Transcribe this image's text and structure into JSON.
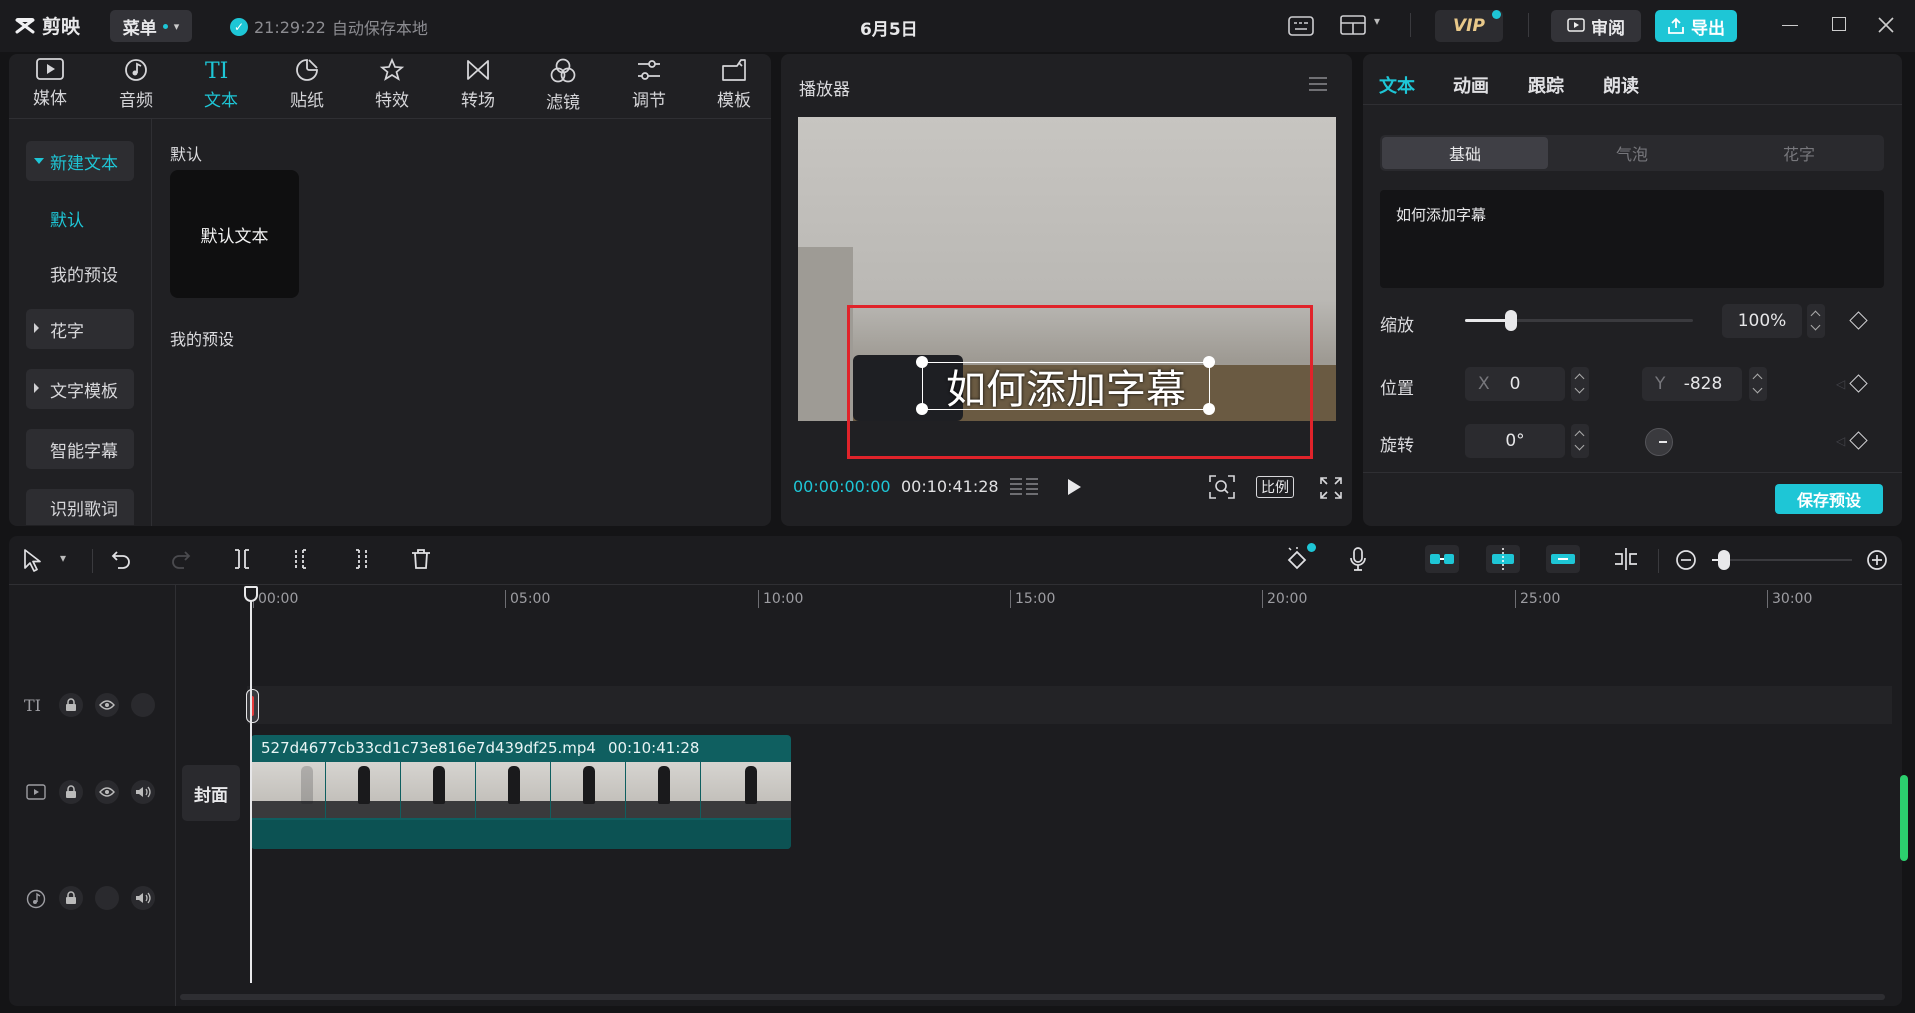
{
  "app": {
    "name": "剪映",
    "menu_label": "菜单",
    "autosave_time": "21:29:22",
    "autosave_text": "自动保存本地",
    "project_title": "6月5日",
    "vip_label": "VIP",
    "review_label": "审阅",
    "export_label": "导出"
  },
  "toolbar": {
    "categories": [
      {
        "label": "媒体",
        "icon": "media-icon"
      },
      {
        "label": "音频",
        "icon": "audio-icon"
      },
      {
        "label": "文本",
        "icon": "text-icon"
      },
      {
        "label": "贴纸",
        "icon": "sticker-icon"
      },
      {
        "label": "特效",
        "icon": "effects-icon"
      },
      {
        "label": "转场",
        "icon": "transition-icon"
      },
      {
        "label": "滤镜",
        "icon": "filter-icon"
      },
      {
        "label": "调节",
        "icon": "adjust-icon"
      },
      {
        "label": "模板",
        "icon": "template-icon"
      }
    ],
    "active": "文本"
  },
  "sidebar": {
    "items": [
      {
        "label": "新建文本"
      },
      {
        "label": "默认"
      },
      {
        "label": "我的预设"
      },
      {
        "label": "花字"
      },
      {
        "label": "文字模板"
      },
      {
        "label": "智能字幕"
      },
      {
        "label": "识别歌词"
      }
    ]
  },
  "library": {
    "section_default": "默认",
    "default_card": "默认文本",
    "section_presets": "我的预设"
  },
  "player": {
    "title": "播放器",
    "overlay_text": "如何添加字幕",
    "current_time": "00:00:00:00",
    "total_time": "00:10:41:28",
    "ratio_label": "比例"
  },
  "inspector": {
    "tabs": [
      "文本",
      "动画",
      "跟踪",
      "朗读"
    ],
    "subtabs": [
      "基础",
      "气泡",
      "花字"
    ],
    "text_value": "如何添加字幕",
    "scale_label": "缩放",
    "scale_value": "100%",
    "scale_fraction": 0.2,
    "position_label": "位置",
    "x_label": "X",
    "x_value": "0",
    "y_label": "Y",
    "y_value": "-828",
    "rotate_label": "旋转",
    "rotate_value": "0°",
    "save_preset_label": "保存预设"
  },
  "timeline": {
    "ruler": [
      "00:00",
      "05:00",
      "10:00",
      "15:00",
      "20:00",
      "25:00",
      "30:00"
    ],
    "cover_label": "封面",
    "clip_name": "527d4677cb33cd1c73e816e7d439df25.mp4",
    "clip_duration": "00:10:41:28"
  },
  "colors": {
    "accent": "#1ec6d6",
    "clip_teal": "#0f5f60",
    "highlight_red": "#e0232a"
  }
}
